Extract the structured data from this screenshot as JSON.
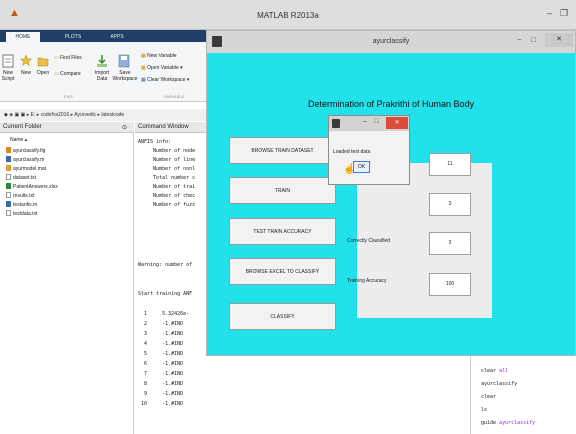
{
  "matlab": {
    "title": "MATLAB R2013a",
    "controls": {
      "minimize": "–",
      "maximize": "❐"
    },
    "tabs": [
      "HOME",
      "PLOTS",
      "APPS"
    ],
    "ribbon": {
      "new_script": "New\nScript",
      "new": "New",
      "open": "Open",
      "find_files": "Find Files",
      "compare": "Compare",
      "import_data": "Import\nData",
      "save_workspace": "Save\nWorkspace",
      "new_variable": "New Variable",
      "open_variable": "Open Variable ▾",
      "clear_workspace": "Clear Workspace ▾",
      "group_file": "FILE",
      "group_variable": "VARIABLE"
    },
    "address": "◆ ◈ ▣ ▣ ▸ E: ▸ codefox2016 ▸ Ayurvedic ▸ latestcode"
  },
  "current_folder": {
    "title": "Current Folder",
    "column_header": "Name ▴",
    "files": [
      {
        "name": "ayurclassify.fig",
        "icon": "fig-file-icon"
      },
      {
        "name": "ayurclassify.m",
        "icon": "m-file-icon"
      },
      {
        "name": "ayurmodel.mat",
        "icon": "mat-file-icon"
      },
      {
        "name": "dataset.txt",
        "icon": "text-file-icon"
      },
      {
        "name": "PatientAnswers.xlsx",
        "icon": "excel-file-icon"
      },
      {
        "name": "results.txt",
        "icon": "text-file-icon"
      },
      {
        "name": "testanfis.m",
        "icon": "m-file-icon"
      },
      {
        "name": "testdata.txt",
        "icon": "text-file-icon"
      }
    ]
  },
  "command_window": {
    "title": "Command Window",
    "lines": [
      "ANFIS info:",
      "     Number of node",
      "     Number of line",
      "     Number of nonl",
      "     Total number c",
      "     Number of trai",
      "     Number of chec",
      "     Number of fuzz",
      "",
      "Warning: number of",
      "",
      "Start training ANF",
      "",
      "  1     5.32426e-",
      "  2     -1.#IND",
      "  3     -1.#IND",
      "  4     -1.#IND",
      "  5     -1.#IND",
      "  6     -1.#IND",
      "  7     -1.#IND",
      "  8     -1.#IND",
      "  9     -1.#IND",
      " 10     -1.#IND"
    ]
  },
  "command_history": [
    {
      "cmd": "clear ",
      "arg": "all"
    },
    {
      "cmd": "ayurclassify",
      "arg": ""
    },
    {
      "cmd": "clear",
      "arg": ""
    },
    {
      "cmd": "ls",
      "arg": ""
    },
    {
      "cmd": "guide ",
      "arg": "ayurclassify"
    }
  ],
  "figure": {
    "title": "ayurclassify",
    "controls": {
      "minimize": "–",
      "maximize": "□",
      "close": "✕"
    },
    "heading": "Determination of Prakrithi of Human Body",
    "buttons": {
      "browse_train": "BROWSE TRAIN DATASET",
      "train": "TRAIN",
      "test_accuracy": "TEST TRAIN ACCURACY",
      "browse_excel": "BROWSE EXCEL TO CLASSIFY",
      "classify": "CLASSIFY"
    },
    "results": {
      "value1": "11",
      "value2": "3",
      "correct_label": "Correctly Classified",
      "correct_value": "3",
      "accuracy_label": "Training Accuracy",
      "accuracy_value": "100"
    }
  },
  "dialog": {
    "controls": {
      "minimize": "–",
      "maximize": "□",
      "close": "✕"
    },
    "message": "Loaded test data",
    "ok": "OK"
  }
}
